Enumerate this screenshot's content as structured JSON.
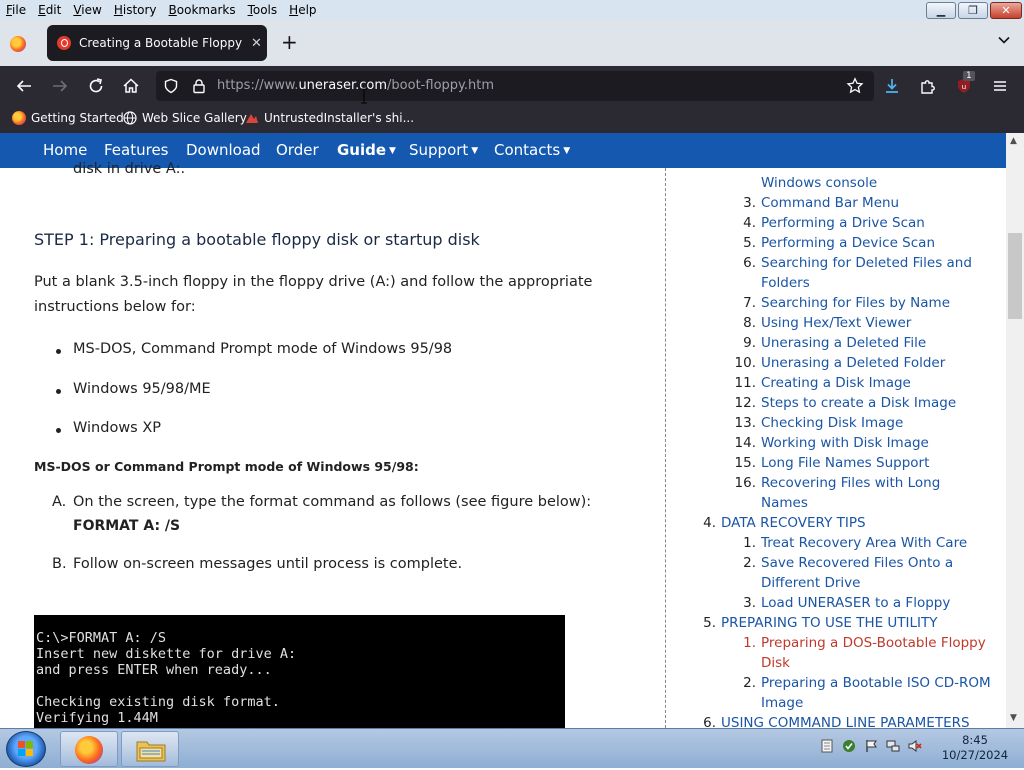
{
  "menubar": {
    "items": [
      "File",
      "Edit",
      "View",
      "History",
      "Bookmarks",
      "Tools",
      "Help"
    ]
  },
  "tab": {
    "title": "Creating a Bootable Floppy Ma",
    "close": "✕"
  },
  "toolbar": {
    "newtab": "+",
    "url_prefix": "https://www.",
    "url_host": "uneraser.com",
    "url_path": "/boot-floppy.htm",
    "extension_badge": "1"
  },
  "bookmarks": [
    {
      "label": "Getting Started",
      "icon": "firefox-icon"
    },
    {
      "label": "Web Slice Gallery",
      "icon": "globe-icon"
    },
    {
      "label": "UntrustedInstaller's shi...",
      "icon": "bookmark-favicon"
    }
  ],
  "sitenav": {
    "items": [
      "Home",
      "Features",
      "Download",
      "Order",
      "Guide",
      "Support",
      "Contacts"
    ]
  },
  "main": {
    "partial_line": "disk in drive A:.",
    "step_heading": "STEP 1: Preparing a bootable floppy disk or startup disk",
    "intro_line1": "Put a blank 3.5-inch floppy in the floppy drive (A:) and follow the appropriate",
    "intro_line2": "instructions below for:",
    "bullets": [
      "MS-DOS, Command Prompt mode of Windows 95/98",
      "Windows 95/98/ME",
      "Windows XP"
    ],
    "subheading": "MS-DOS or Command Prompt mode of Windows 95/98:",
    "step_a_marker": "A.",
    "step_a_text": "On the screen, type the format command as follows (see figure below):",
    "step_a_command": "FORMAT A: /S",
    "step_b_marker": "B.",
    "step_b_text": "Follow on-screen messages until process is complete."
  },
  "terminal": {
    "lines": [
      "C:\\>FORMAT A: /S",
      "Insert new diskette for drive A:",
      "and press ENTER when ready...",
      "",
      "Checking existing disk format.",
      "Verifying 1.44M"
    ]
  },
  "toc": {
    "partial": "Windows console",
    "items": [
      {
        "num": "3.",
        "label": "Command Bar Menu"
      },
      {
        "num": "4.",
        "label": "Performing a Drive Scan"
      },
      {
        "num": "5.",
        "label": "Performing a Device Scan"
      },
      {
        "num": "6.",
        "label": "Searching for Deleted Files and",
        "cont": "Folders"
      },
      {
        "num": "7.",
        "label": "Searching for Files by Name"
      },
      {
        "num": "8.",
        "label": "Using Hex/Text Viewer"
      },
      {
        "num": "9.",
        "label": "Unerasing a Deleted File"
      },
      {
        "num": "10.",
        "label": "Unerasing a Deleted Folder"
      },
      {
        "num": "11.",
        "label": "Creating a Disk Image"
      },
      {
        "num": "12.",
        "label": "Steps to create a Disk Image"
      },
      {
        "num": "13.",
        "label": "Checking Disk Image"
      },
      {
        "num": "14.",
        "label": "Working with Disk Image"
      },
      {
        "num": "15.",
        "label": "Long File Names Support"
      },
      {
        "num": "16.",
        "label": "Recovering Files with Long",
        "cont": "Names"
      }
    ],
    "section4": {
      "num": "4.",
      "label": "DATA RECOVERY TIPS"
    },
    "section4_items": [
      {
        "num": "1.",
        "label": "Treat Recovery Area With Care"
      },
      {
        "num": "2.",
        "label": "Save Recovered Files Onto a",
        "cont": "Different Drive"
      },
      {
        "num": "3.",
        "label": "Load UNERASER to a Floppy"
      }
    ],
    "section5": {
      "num": "5.",
      "label": "PREPARING TO USE THE UTILITY"
    },
    "section5_items": [
      {
        "num": "1.",
        "label": "Preparing a DOS-Bootable Floppy",
        "cont": "Disk",
        "active": true
      },
      {
        "num": "2.",
        "label": "Preparing a Bootable ISO CD-ROM",
        "cont": "Image"
      }
    ],
    "section6": {
      "num": "6.",
      "label": "USING COMMAND LINE PARAMETERS"
    }
  },
  "taskbar": {
    "time": "8:45",
    "date": "10/27/2024"
  },
  "colors": {
    "site_nav": "#1458b0",
    "link": "#1a55a6",
    "active_link": "#c0392b",
    "toolbar": "#2b2a33"
  }
}
